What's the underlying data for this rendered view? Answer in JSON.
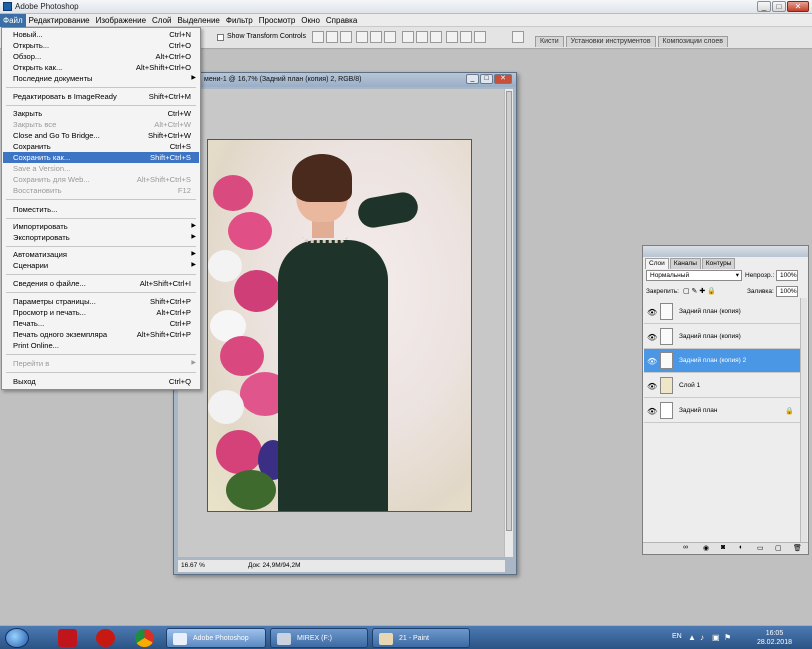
{
  "titlebar": {
    "title": "Adobe Photoshop"
  },
  "menubar": [
    "Файл",
    "Редактирование",
    "Изображение",
    "Слой",
    "Выделение",
    "Фильтр",
    "Просмотр",
    "Окно",
    "Справка"
  ],
  "options": {
    "show_transform": "Show Transform Controls"
  },
  "palette_wells": [
    "Кисти",
    "Установки инструментов",
    "Композиции слоев"
  ],
  "document": {
    "title": "мени-1 @ 16,7% (Задний план (копия) 2, RGB/8)",
    "zoom": "16.67 %",
    "info": "Док: 24,9M/94,2M"
  },
  "file_menu": [
    {
      "label": "Новый...",
      "shortcut": "Ctrl+N"
    },
    {
      "label": "Открыть...",
      "shortcut": "Ctrl+O"
    },
    {
      "label": "Обзор...",
      "shortcut": "Alt+Ctrl+O"
    },
    {
      "label": "Открыть как...",
      "shortcut": "Alt+Shift+Ctrl+O"
    },
    {
      "label": "Последние документы",
      "shortcut": "",
      "submenu": true
    },
    {
      "label": "Редактировать в ImageReady",
      "shortcut": "Shift+Ctrl+M"
    },
    {
      "label": "Закрыть",
      "shortcut": "Ctrl+W"
    },
    {
      "label": "Закрыть все",
      "shortcut": "Alt+Ctrl+W",
      "disabled": true
    },
    {
      "label": "Close and Go To Bridge...",
      "shortcut": "Shift+Ctrl+W"
    },
    {
      "label": "Сохранить",
      "shortcut": "Ctrl+S"
    },
    {
      "label": "Сохранить как...",
      "shortcut": "Shift+Ctrl+S",
      "highlighted": true
    },
    {
      "label": "Save a Version...",
      "shortcut": "",
      "disabled": true
    },
    {
      "label": "Сохранить для Web...",
      "shortcut": "Alt+Shift+Ctrl+S",
      "disabled": true
    },
    {
      "label": "Восстановить",
      "shortcut": "F12",
      "disabled": true
    },
    {
      "label": "Поместить...",
      "shortcut": ""
    },
    {
      "label": "Импортировать",
      "shortcut": "",
      "submenu": true
    },
    {
      "label": "Экспортировать",
      "shortcut": "",
      "submenu": true
    },
    {
      "label": "Автоматизация",
      "shortcut": "",
      "submenu": true
    },
    {
      "label": "Сценарии",
      "shortcut": "",
      "submenu": true
    },
    {
      "label": "Сведения о файле...",
      "shortcut": "Alt+Shift+Ctrl+I"
    },
    {
      "label": "Параметры страницы...",
      "shortcut": "Shift+Ctrl+P"
    },
    {
      "label": "Просмотр и печать...",
      "shortcut": "Alt+Ctrl+P"
    },
    {
      "label": "Печать...",
      "shortcut": "Ctrl+P"
    },
    {
      "label": "Печать одного экземпляра",
      "shortcut": "Alt+Shift+Ctrl+P"
    },
    {
      "label": "Print Online...",
      "shortcut": ""
    },
    {
      "label": "Перейти в",
      "shortcut": "",
      "submenu": true,
      "disabled": true
    },
    {
      "label": "Выход",
      "shortcut": "Ctrl+Q"
    }
  ],
  "layers_panel": {
    "tabs": [
      "Слои",
      "Каналы",
      "Контуры"
    ],
    "blend_mode": "Нормальный",
    "opacity_label": "Непрозр.:",
    "opacity": "100%",
    "lock_label": "Закрепить:",
    "fill_label": "Заливка:",
    "fill": "100%",
    "layers": [
      {
        "name": "Задний план (копия)",
        "selected": false
      },
      {
        "name": "Задний план (копия)",
        "selected": false
      },
      {
        "name": "Задний план (копия) 2",
        "selected": true
      },
      {
        "name": "Слой 1",
        "selected": false
      },
      {
        "name": "Задний план",
        "selected": false,
        "locked": true
      }
    ]
  },
  "taskbar": {
    "tasks": [
      "Adobe Photoshop",
      "MIREX (F:)",
      "21 - Paint"
    ],
    "lang": "EN",
    "time": "16:05",
    "date": "28.02.2018"
  },
  "colors": {
    "menu_highlight": "#3d74c4",
    "layer_selected": "#4a97e5",
    "taskbar": "#2b5384",
    "dress": "#1e3329"
  }
}
